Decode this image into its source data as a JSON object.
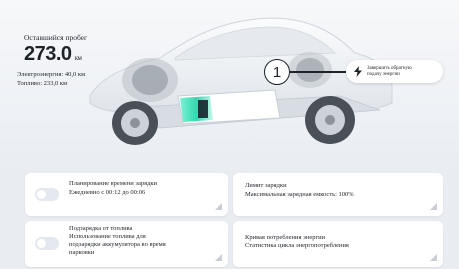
{
  "range": {
    "title": "Оставшийся пробег",
    "value": "273.0",
    "unit": "км",
    "electric": "Электроэнергия: 40,0 км",
    "fuel": "Топливо: 233,0 км"
  },
  "callout": {
    "number": "1",
    "pill_line1": "Завершить обратную",
    "pill_line2": "подачу энергии",
    "pill_icon": "lightning-bolt-icon"
  },
  "cards": {
    "schedule": {
      "line1": "Планирование времени зарядки",
      "line2": "Ежедневно с 00:12 до 00:06",
      "toggle_on": false
    },
    "limit": {
      "line1": "Лимит зарядки",
      "line2": "Максимальная зарядная емкость: 100%"
    },
    "fuel_charge": {
      "line1": "Подзарядка от топлива",
      "line2": "Использование топлива для",
      "line3": "подзарядки аккумулятора во время",
      "line4": "парковки",
      "toggle_on": false
    },
    "curve": {
      "line1": "Кривая потребления энергии",
      "line2": "Статистика цикла энергопотребления"
    }
  },
  "colors": {
    "battery_accent": "#2fd9b0",
    "background": "#e9edf2"
  }
}
